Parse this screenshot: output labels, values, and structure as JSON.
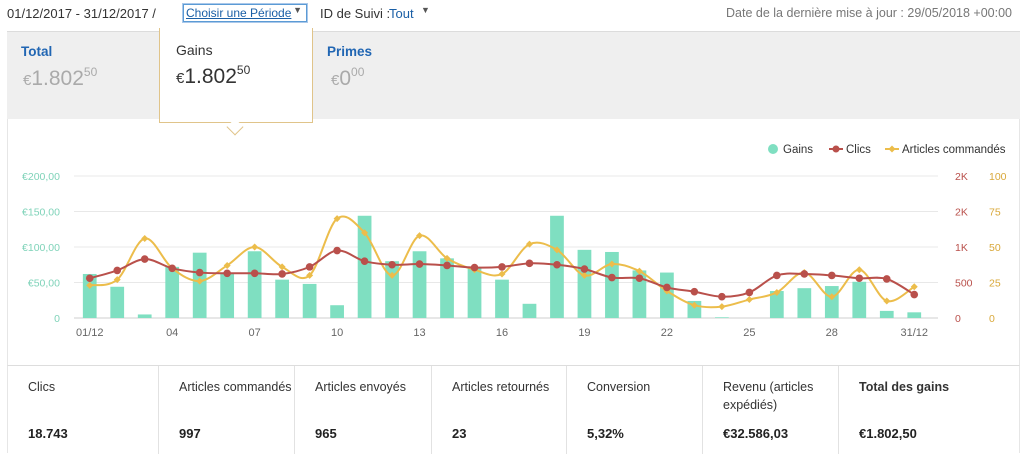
{
  "topbar": {
    "date_range": "01/12/2017 - 31/12/2017 /",
    "period_select": "Choisir une Période",
    "tracking_label": "ID de Suivi :",
    "tracking_value": "Tout",
    "last_update": "Date de la dernière mise à jour : 29/05/2018 +00:00"
  },
  "summary": {
    "total": {
      "label": "Total",
      "currency": "€",
      "integer": "1.802",
      "decimal": "50"
    },
    "gains": {
      "label": "Gains",
      "currency": "€",
      "integer": "1.802",
      "decimal": "50"
    },
    "primes": {
      "label": "Primes",
      "currency": "€",
      "integer": "0",
      "decimal": "00"
    }
  },
  "colors": {
    "gains": "#7fdfc1",
    "clics": "#b9504b",
    "articles": "#ecbd4b",
    "link": "#2166b3"
  },
  "chart_data": {
    "type": "bar",
    "legend": [
      "Gains",
      "Clics",
      "Articles commandés"
    ],
    "legend_position": "top-right",
    "x_labels": [
      "01/12",
      "04",
      "07",
      "10",
      "13",
      "16",
      "19",
      "22",
      "25",
      "28",
      "31/12"
    ],
    "x": [
      1,
      2,
      3,
      4,
      5,
      6,
      7,
      8,
      9,
      10,
      11,
      12,
      13,
      14,
      15,
      16,
      17,
      18,
      19,
      20,
      21,
      22,
      23,
      24,
      25,
      26,
      27,
      28,
      29,
      30,
      31
    ],
    "y_left_ticks": [
      "€200,00",
      "€150,00",
      "€100,00",
      "€50,00",
      "0"
    ],
    "y_clics_ticks": [
      "2K",
      "2K",
      "1K",
      "500",
      "0"
    ],
    "y_articles_ticks": [
      "100",
      "75",
      "50",
      "25",
      "0"
    ],
    "ylim_gains": [
      0,
      200
    ],
    "ylim_clics": [
      0,
      2000
    ],
    "ylim_articles": [
      0,
      100
    ],
    "series": [
      {
        "name": "Gains",
        "type": "bar",
        "values": [
          62,
          44,
          5,
          72,
          92,
          64,
          94,
          54,
          48,
          18,
          144,
          80,
          94,
          84,
          72,
          54,
          20,
          144,
          96,
          93,
          67,
          64,
          24,
          1,
          0,
          38,
          42,
          45,
          51,
          10,
          8
        ]
      },
      {
        "name": "Clics",
        "type": "line",
        "values": [
          560,
          670,
          830,
          700,
          640,
          630,
          630,
          620,
          720,
          950,
          800,
          750,
          760,
          740,
          710,
          720,
          770,
          750,
          690,
          570,
          560,
          430,
          370,
          300,
          360,
          600,
          620,
          600,
          560,
          550,
          330
        ]
      },
      {
        "name": "Articles commandés",
        "type": "line",
        "values": [
          23,
          27,
          56,
          35,
          26,
          37,
          50,
          36,
          30,
          70,
          60,
          30,
          58,
          42,
          34,
          31,
          52,
          48,
          30,
          38,
          33,
          19,
          9,
          8,
          13,
          18,
          32,
          15,
          34,
          12,
          22
        ]
      }
    ]
  },
  "stats": [
    {
      "label": "Clics",
      "value": "18.743"
    },
    {
      "label": "Articles commandés",
      "value": "997"
    },
    {
      "label": "Articles envoyés",
      "value": "965"
    },
    {
      "label": "Articles retournés",
      "value": "23"
    },
    {
      "label": "Conversion",
      "value": "5,32%"
    },
    {
      "label": "Revenu (articles expédiés)",
      "value": "€32.586,03"
    },
    {
      "label": "Total des gains",
      "value": "€1.802,50"
    }
  ]
}
